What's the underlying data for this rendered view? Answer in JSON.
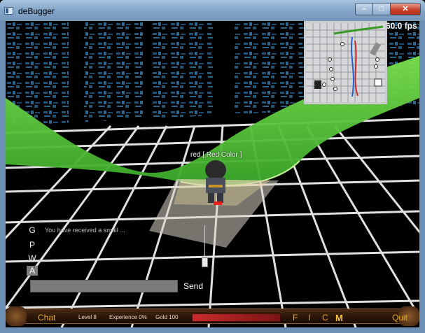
{
  "window": {
    "title": "deBugger",
    "minimize_label": "–",
    "maximize_label": "□",
    "close_label": "✕"
  },
  "overlay": {
    "fps": "60.0 fps",
    "player_name": "red [ Red Color ]"
  },
  "chat": {
    "tabs": [
      "G",
      "P",
      "W",
      "A"
    ],
    "active_tab": "A",
    "messages": [
      "You have received a small ..."
    ],
    "input_value": "",
    "send_label": "Send"
  },
  "hud": {
    "chat_label": "Chat",
    "level": "Level 8",
    "experience": "Experience 0%",
    "gold": "Gold 100",
    "letters": [
      "F",
      "I",
      "C",
      "M"
    ],
    "quit_label": "Quit",
    "gold_fill": 1.0
  },
  "colors": {
    "grid_green": "#9ef06a",
    "floor_grid": "#ffffff",
    "hud_text": "#e8a820",
    "terrain": "#55d83a"
  },
  "icons": {
    "window_icon": "app-icon",
    "minimap": "minimap"
  }
}
